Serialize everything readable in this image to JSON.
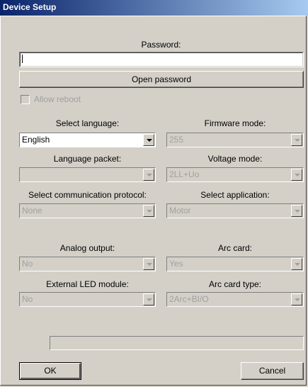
{
  "window": {
    "title": "Device Setup"
  },
  "password": {
    "label": "Password:",
    "value": ""
  },
  "open_password_button": "Open password",
  "allow_reboot": {
    "label": "Allow reboot",
    "checked": false
  },
  "select_language": {
    "label": "Select language:",
    "value": "English"
  },
  "firmware_mode": {
    "label": "Firmware mode:",
    "value": "255"
  },
  "language_packet": {
    "label": "Language packet:",
    "value": ""
  },
  "voltage_mode": {
    "label": "Voltage mode:",
    "value": "2LL+Uo"
  },
  "communication_protocol": {
    "label": "Select communication protocol:",
    "value": "None"
  },
  "select_application": {
    "label": "Select application:",
    "value": "Motor"
  },
  "analog_output": {
    "label": "Analog output:",
    "value": "No"
  },
  "arc_card": {
    "label": "Arc card:",
    "value": "Yes"
  },
  "external_led_module": {
    "label": "External LED module:",
    "value": "No"
  },
  "arc_card_type": {
    "label": "Arc card type:",
    "value": "2Arc+BI/O"
  },
  "buttons": {
    "ok": "OK",
    "cancel": "Cancel"
  }
}
